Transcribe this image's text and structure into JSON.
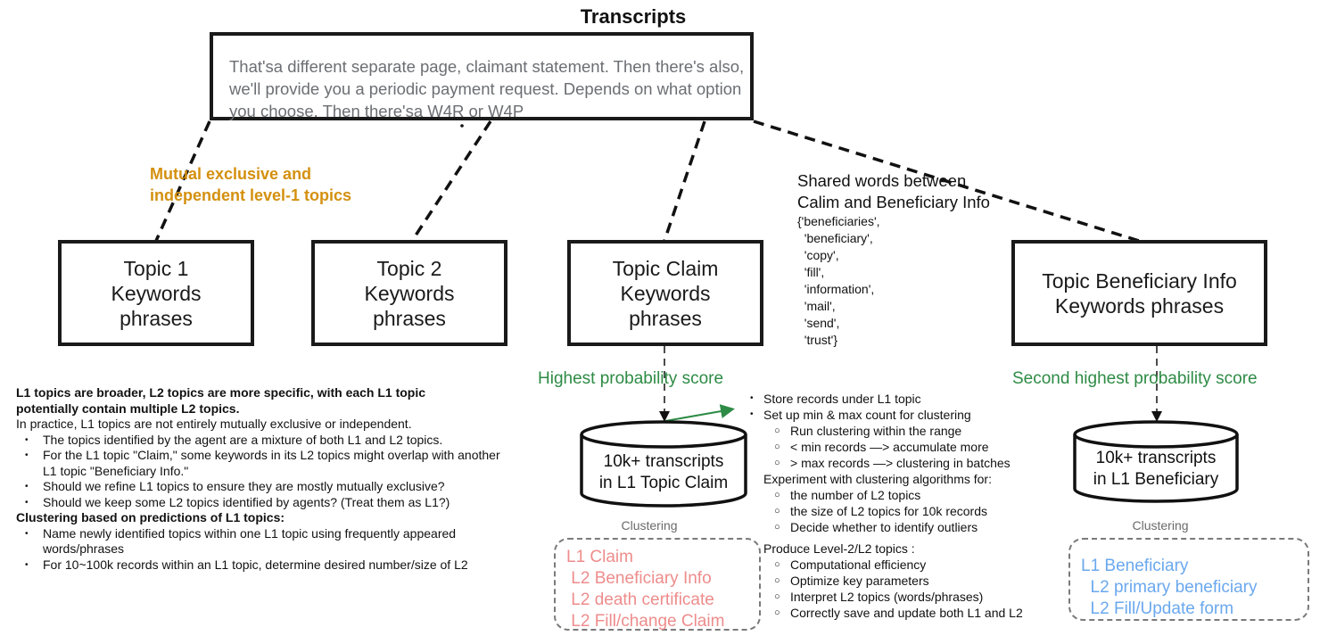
{
  "title": "Transcripts",
  "transcript_text": "That'sa different separate page, claimant statement. Then there's also, we'll provide you a periodic payment request. Depends on what option you choose. Then there'sa W4R or W4P",
  "annotation_mutual": [
    "Mutual exclusive and",
    "independent level-1 topics"
  ],
  "topics": [
    {
      "lines": [
        "Topic 1",
        "Keywords",
        "phrases"
      ]
    },
    {
      "lines": [
        "Topic 2",
        "Keywords",
        "phrases"
      ]
    },
    {
      "lines": [
        "Topic Claim",
        "Keywords",
        "phrases"
      ]
    },
    {
      "lines": [
        "Topic Beneficiary Info",
        "Keywords phrases"
      ]
    }
  ],
  "shared_words": {
    "header": [
      "Shared words between",
      "Calim and Beneficiary Info"
    ],
    "words": [
      "{'beneficiaries',",
      "  'beneficiary',",
      "  'copy',",
      "  'fill',",
      "  'information',",
      "  'mail',",
      "  'send',",
      "  'trust'}"
    ]
  },
  "probability_labels": {
    "claim": "Highest probability score",
    "beneficiary": "Second highest probability score"
  },
  "databases": {
    "claim": [
      "10k+ transcripts",
      "in L1 Topic Claim"
    ],
    "beneficiary": [
      "10k+ transcripts",
      "in L1  Beneficiary"
    ]
  },
  "clustering": {
    "label": "Clustering",
    "claim": [
      "L1 Claim",
      " L2 Beneficiary Info",
      " L2 death certificate",
      " L2 Fill/change Claim"
    ],
    "beneficiary": [
      "L1 Beneficiary",
      "  L2 primary beneficiary",
      "  L2 Fill/Update form"
    ]
  },
  "notes": {
    "heading": [
      "L1 topics are broader,  L2 topics are more specific, with each L1 topic",
      "potentially contain multiple L2 topics."
    ],
    "intro": "In practice, L1 topics are not entirely mutually exclusive or independent.",
    "bullets": [
      "The topics identified by the agent are a mixture of both L1 and L2 topics.",
      " For the L1 topic \"Claim,\" some keywords in its L2 topics might overlap with another L1 topic \"Beneficiary Info.\"",
      "Should we refine L1 topics to ensure they are mostly mutually exclusive?",
      "Should we keep some L2 topics identified by agents? (Treat them as L1?)"
    ],
    "clustering_heading": "Clustering based on predictions of L1 topics:",
    "clustering_bullets": [
      "Name newly identified topics within one L1 topic using frequently appeared words/phrases",
      "For 10~100k records within an L1 topic, determine desired number/size of L2"
    ]
  },
  "steps": {
    "bullets": [
      "Store records under L1 topic",
      "Set up min & max count for clustering"
    ],
    "minmax_sub": [
      "Run clustering within the  range",
      "< min records —> accumulate more",
      "> max records —> clustering in batches"
    ],
    "experiment": "Experiment  with clustering algorithms for:",
    "experiment_sub": [
      "the number of L2 topics",
      "the size of L2 topics for 10k records",
      "Decide whether to identify outliers"
    ],
    "produce": "Produce Level-2/L2 topics :",
    "produce_sub": [
      "Computational efficiency",
      "Optimize key parameters",
      "Interpret L2 topics (words/phrases)",
      "Correctly save and update both L1 and L2"
    ]
  },
  "colors": {
    "annotation": "#d4900f",
    "probability": "#2e8b45",
    "claim_clusters": "#ee8c8c",
    "beneficiary_clusters": "#6aa8ee"
  }
}
